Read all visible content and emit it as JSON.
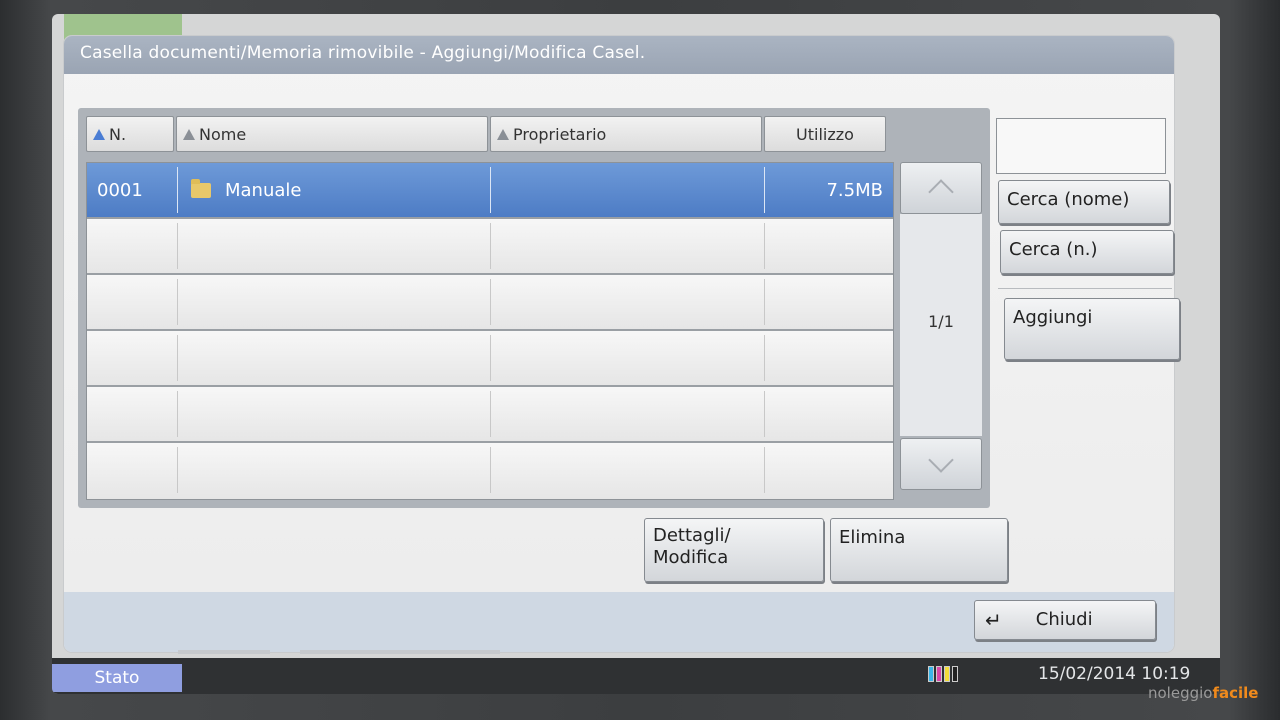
{
  "header": {
    "title": "Casella documenti/Memoria rimovibile - Aggiungi/Modifica Casel."
  },
  "table": {
    "columns": [
      {
        "label": "N.",
        "sorted": true
      },
      {
        "label": "Nome",
        "sorted": false
      },
      {
        "label": "Proprietario",
        "sorted": false
      },
      {
        "label": "Utilizzo",
        "sorted": false
      }
    ],
    "rows": [
      {
        "number": "0001",
        "name": "Manuale",
        "owner": "",
        "usage": "7.5MB",
        "selected": true
      }
    ],
    "page_indicator": "1/1"
  },
  "actions": {
    "search_name": "Cerca (nome)",
    "search_number": "Cerca (n.)",
    "add": "Aggiungi",
    "details_line1": "Dettagli/",
    "details_line2": "Modifica",
    "delete": "Elimina",
    "close": "Chiudi"
  },
  "status_bar": {
    "status_label": "Stato",
    "datetime": "15/02/2014 10:19"
  },
  "watermark": {
    "part1": "noleggio",
    "part2": "facile"
  },
  "colors": {
    "selected_row": "#5a87cc",
    "title_bar": "#a2adbc",
    "status_button": "#8f9ee0",
    "watermark_accent": "#f08a1c"
  },
  "icons": [
    "sort-asc-icon",
    "sort-icon",
    "folder-icon",
    "chevron-up-icon",
    "chevron-down-icon",
    "return-arrow-icon",
    "toner-level-icon"
  ]
}
